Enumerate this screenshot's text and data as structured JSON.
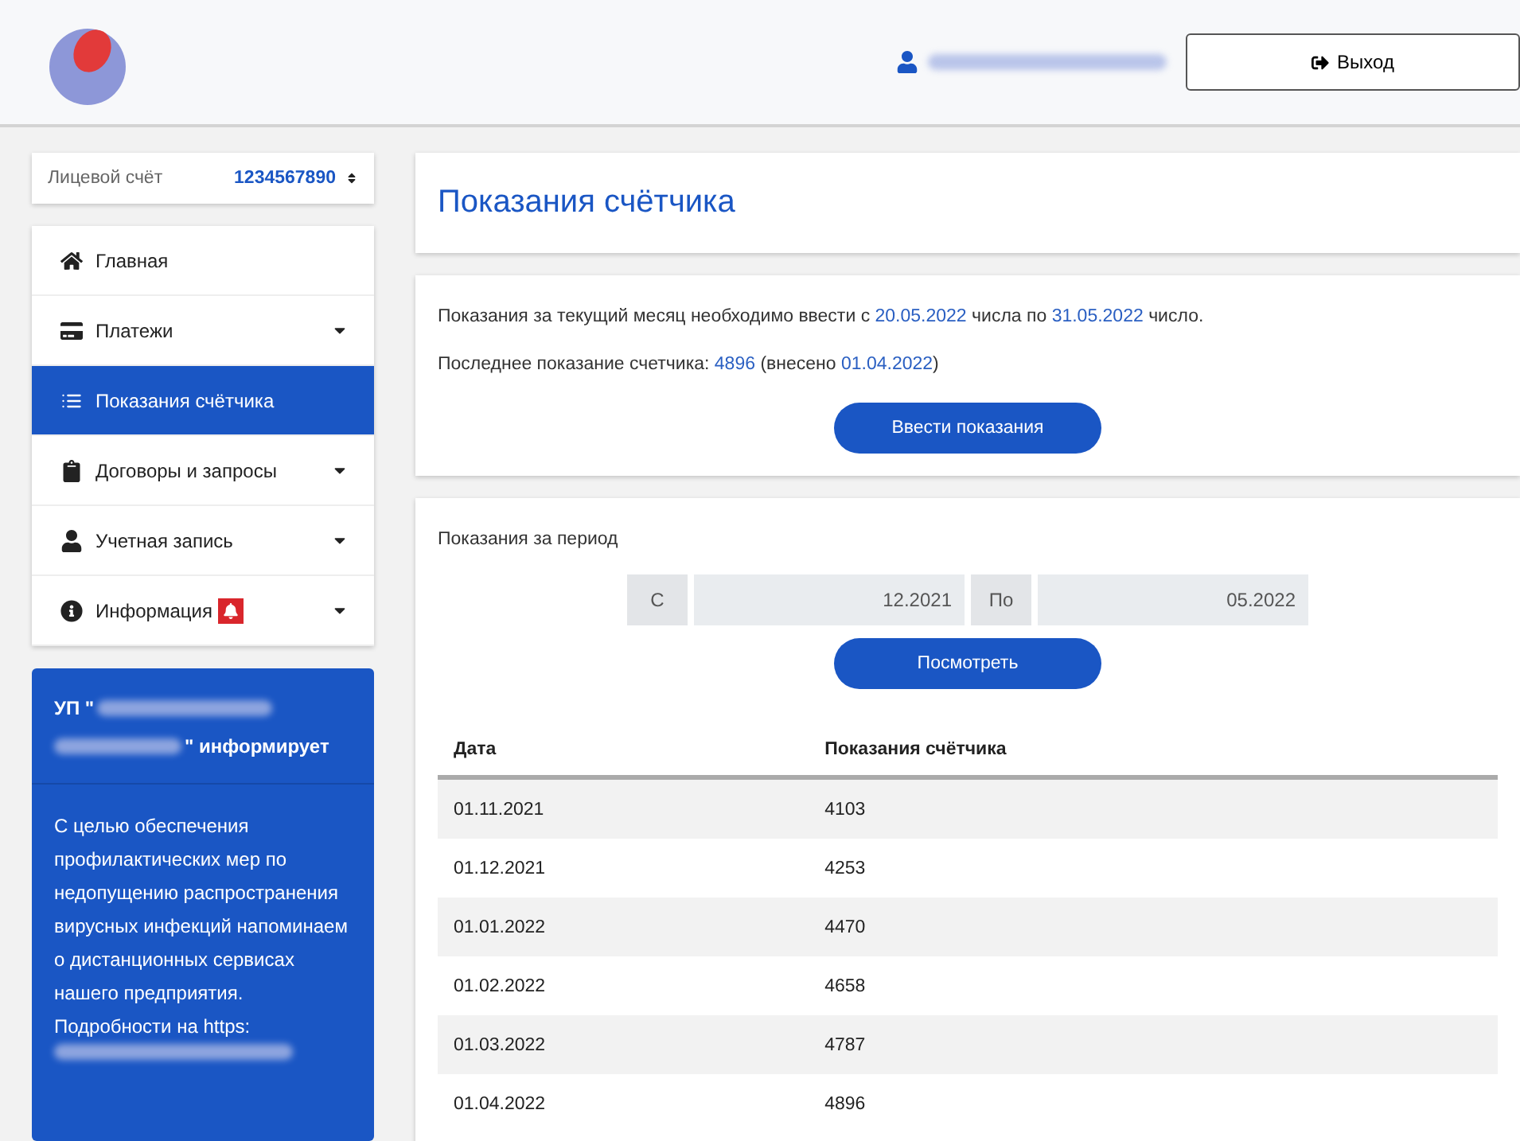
{
  "header": {
    "logout": "Выход"
  },
  "account": {
    "label": "Лицевой счёт",
    "number": "1234567890"
  },
  "menu": [
    {
      "label": "Главная",
      "kind": "home",
      "dropdown": false,
      "selected": false
    },
    {
      "label": "Платежи",
      "kind": "card",
      "dropdown": true,
      "selected": false
    },
    {
      "label": "Показания счётчика",
      "kind": "list",
      "dropdown": false,
      "selected": true
    },
    {
      "label": "Договоры и запросы",
      "kind": "clipboard",
      "dropdown": true,
      "selected": false
    },
    {
      "label": "Учетная запись",
      "kind": "user",
      "dropdown": true,
      "selected": false
    },
    {
      "label": "Информация",
      "kind": "info",
      "dropdown": true,
      "selected": false,
      "alert": true
    }
  ],
  "notice": {
    "title_start": "УП \"",
    "title_end": "\" информирует",
    "body": "С целью обеспечения профилактических мер по недопущению распространения вирусных инфекций напоминаем о дистанционных сервисах нашего предприятия. Подробности на https:"
  },
  "page_title": "Показания счётчика",
  "info_lines": [
    [
      {
        "text": "Показания за текущий месяц необходимо ввести с ",
        "kind": "plain"
      },
      {
        "text": "20.05.2022",
        "kind": "link"
      },
      {
        "text": " числа по ",
        "kind": "plain"
      },
      {
        "text": "31.05.2022",
        "kind": "link"
      },
      {
        "text": " число.",
        "kind": "plain"
      }
    ],
    [
      {
        "text": "Последнее показание счетчика: ",
        "kind": "plain"
      },
      {
        "text": "4896",
        "kind": "link"
      },
      {
        "text": " (внесено ",
        "kind": "plain"
      },
      {
        "text": "01.04.2022",
        "kind": "link"
      },
      {
        "text": ")",
        "kind": "plain"
      }
    ]
  ],
  "enter_button": "Ввести показания",
  "period": {
    "label": "Показания за период",
    "from_label": "С",
    "from_value": "12.2021",
    "to_label": "По",
    "to_value": "05.2022",
    "button": "Посмотреть"
  },
  "table": {
    "columns": [
      "Дата",
      "Показания счётчика"
    ],
    "rows": [
      [
        "01.11.2021",
        "4103"
      ],
      [
        "01.12.2021",
        "4253"
      ],
      [
        "01.01.2022",
        "4470"
      ],
      [
        "01.02.2022",
        "4658"
      ],
      [
        "01.03.2022",
        "4787"
      ],
      [
        "01.04.2022",
        "4896"
      ]
    ]
  }
}
